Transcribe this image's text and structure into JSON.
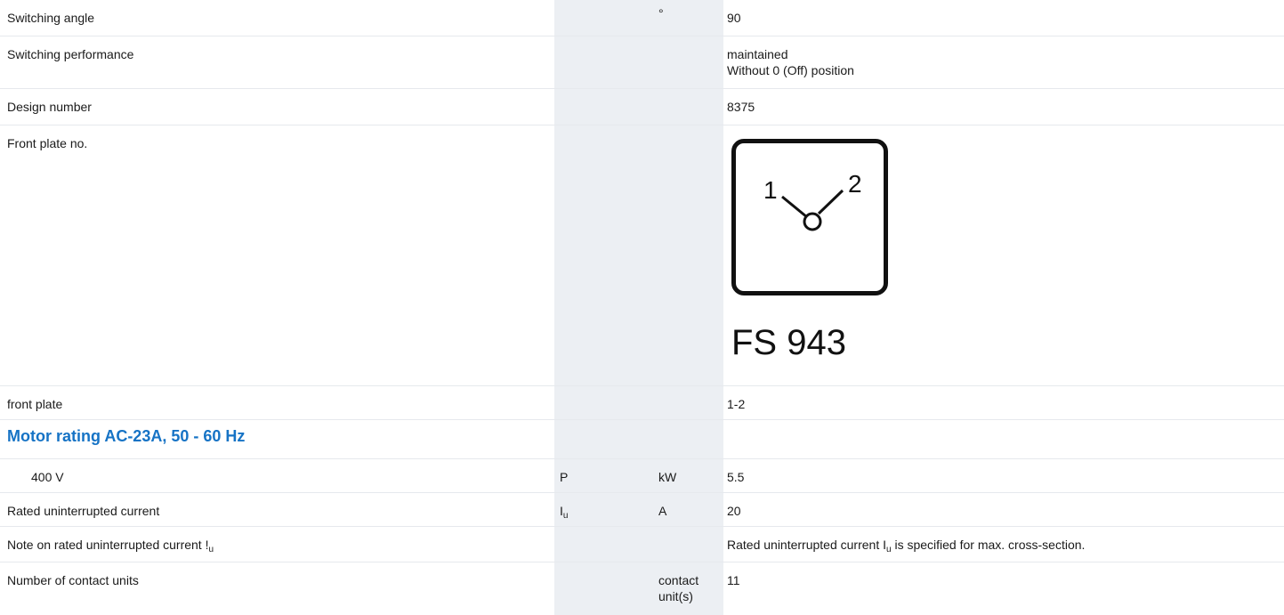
{
  "rows": [
    {
      "label": "Switching angle",
      "symbol": "",
      "unit": "°",
      "value": "90"
    },
    {
      "label": "Switching performance",
      "symbol": "",
      "unit": "",
      "value_lines": [
        "maintained",
        "Without 0 (Off) position"
      ]
    },
    {
      "label": "Design number",
      "symbol": "",
      "unit": "",
      "value": "8375"
    },
    {
      "label": "Front plate no.",
      "symbol": "",
      "unit": "",
      "front_plate": {
        "pos1": "1",
        "pos2": "2",
        "code": "FS 943"
      }
    },
    {
      "label": "front plate",
      "symbol": "",
      "unit": "",
      "value": "1-2"
    }
  ],
  "section": {
    "title": "Motor rating AC-23A, 50 - 60 Hz"
  },
  "motor_row": {
    "label": "400 V",
    "symbol": "P",
    "unit": "kW",
    "value": "5.5"
  },
  "current_row": {
    "label": "Rated uninterrupted current",
    "symbol_main": "I",
    "symbol_sub": "u",
    "unit": "A",
    "value": "20"
  },
  "note_row": {
    "label_main": "Note on rated uninterrupted current !",
    "label_sub": "u",
    "value_pre": "Rated uninterrupted current I",
    "value_sub": "u",
    "value_post": " is specified for max. cross-section."
  },
  "contact_row": {
    "label": "Number of contact units",
    "unit_lines": [
      "contact",
      "unit(s)"
    ],
    "value": "11"
  },
  "colors": {
    "accent": "#1673c5",
    "shade": "#eceff3",
    "border": "#e6e9ed"
  }
}
